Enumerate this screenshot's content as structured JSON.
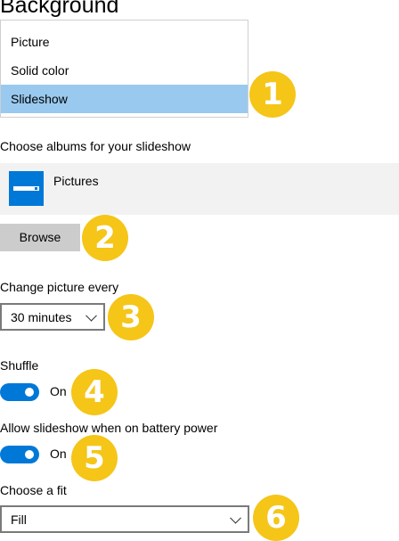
{
  "page": {
    "title": "Background"
  },
  "background_dropdown": {
    "options": [
      "Picture",
      "Solid color",
      "Slideshow"
    ],
    "selected": "Slideshow"
  },
  "albums": {
    "label": "Choose albums for your slideshow",
    "items": [
      {
        "name": "Pictures",
        "icon": "folder-icon"
      }
    ],
    "browse_label": "Browse"
  },
  "change_picture": {
    "label": "Change picture every",
    "value": "30 minutes"
  },
  "shuffle": {
    "label": "Shuffle",
    "state": "On"
  },
  "battery": {
    "label": "Allow slideshow when on battery power",
    "state": "On"
  },
  "fit": {
    "label": "Choose a fit",
    "value": "Fill"
  },
  "annotations": [
    "1",
    "2",
    "3",
    "4",
    "5",
    "6"
  ],
  "colors": {
    "accent": "#0078d7",
    "selection": "#99c9ef",
    "badge": "#f5c518",
    "button": "#cccccc",
    "row": "#f2f2f2"
  }
}
